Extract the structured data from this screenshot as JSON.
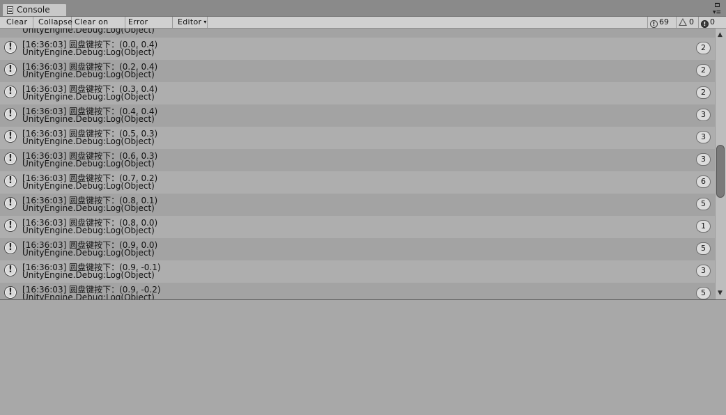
{
  "window": {
    "tab_title": "Console",
    "menu_glyph": "▾≡"
  },
  "toolbar": {
    "clear": "Clear",
    "collapse": "Collapse",
    "clear_on_play": "Clear on Play",
    "error_pause": "Error Pause",
    "editor": "Editor",
    "log_count": "69",
    "warning_count": "0",
    "error_count": "0"
  },
  "top_partial_row": {
    "line2": "UnityEngine.Debug:Log(Object)"
  },
  "log_entries": [
    {
      "line1": "[16:36:03] 圆盘键按下：(0.0, 0.4)",
      "line2": "UnityEngine.Debug:Log(Object)",
      "count": "2"
    },
    {
      "line1": "[16:36:03] 圆盘键按下：(0.2, 0.4)",
      "line2": "UnityEngine.Debug:Log(Object)",
      "count": "2"
    },
    {
      "line1": "[16:36:03] 圆盘键按下：(0.3, 0.4)",
      "line2": "UnityEngine.Debug:Log(Object)",
      "count": "2"
    },
    {
      "line1": "[16:36:03] 圆盘键按下：(0.4, 0.4)",
      "line2": "UnityEngine.Debug:Log(Object)",
      "count": "3"
    },
    {
      "line1": "[16:36:03] 圆盘键按下：(0.5, 0.3)",
      "line2": "UnityEngine.Debug:Log(Object)",
      "count": "3"
    },
    {
      "line1": "[16:36:03] 圆盘键按下：(0.6, 0.3)",
      "line2": "UnityEngine.Debug:Log(Object)",
      "count": "3"
    },
    {
      "line1": "[16:36:03] 圆盘键按下：(0.7, 0.2)",
      "line2": "UnityEngine.Debug:Log(Object)",
      "count": "6"
    },
    {
      "line1": "[16:36:03] 圆盘键按下：(0.8, 0.1)",
      "line2": "UnityEngine.Debug:Log(Object)",
      "count": "5"
    },
    {
      "line1": "[16:36:03] 圆盘键按下：(0.8, 0.0)",
      "line2": "UnityEngine.Debug:Log(Object)",
      "count": "1"
    },
    {
      "line1": "[16:36:03] 圆盘键按下：(0.9, 0.0)",
      "line2": "UnityEngine.Debug:Log(Object)",
      "count": "5"
    },
    {
      "line1": "[16:36:03] 圆盘键按下：(0.9, -0.1)",
      "line2": "UnityEngine.Debug:Log(Object)",
      "count": "3"
    },
    {
      "line1": "[16:36:03] 圆盘键按下：(0.9, -0.2)",
      "line2": "UnityEngine.Debug:Log(Object)",
      "count": "5"
    }
  ],
  "icons": {
    "log": "!",
    "scroll_up": "▲",
    "scroll_down": "▼"
  }
}
